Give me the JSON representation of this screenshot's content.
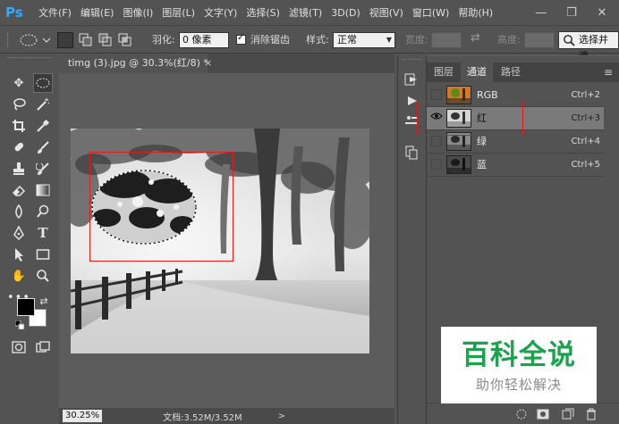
{
  "app": {
    "logo": "Ps"
  },
  "menu": [
    "文件(F)",
    "编辑(E)",
    "图像(I)",
    "图层(L)",
    "文字(Y)",
    "选择(S)",
    "滤镜(T)",
    "3D(D)",
    "视图(V)",
    "窗口(W)",
    "帮助(H)"
  ],
  "window_controls": {
    "minimize": "—",
    "restore": "❐",
    "close": "✕"
  },
  "options": {
    "feather_label": "羽化:",
    "feather_value": "0 像素",
    "antialias_label": "消除锯齿",
    "antialias_checked": true,
    "style_label": "样式:",
    "style_value": "正常",
    "width_label": "宽度:",
    "height_label": "高度:",
    "select_mask_button": "选择并遮"
  },
  "document": {
    "tab_title": "timg (3).jpg @ 30.3%(红/8) *",
    "tab_close": "×",
    "zoom": "30.25%",
    "doc_size": "文档:3.52M/3.52M",
    "status_arrow": ">"
  },
  "panel": {
    "tabs": [
      "图层",
      "通道",
      "路径"
    ],
    "active_tab": "通道",
    "menu_icon": "≡",
    "channels": [
      {
        "name": "RGB",
        "shortcut": "Ctrl+2",
        "visible": false,
        "active": false,
        "thumb_color": "color"
      },
      {
        "name": "红",
        "shortcut": "Ctrl+3",
        "visible": true,
        "active": true,
        "thumb_color": "bright"
      },
      {
        "name": "绿",
        "shortcut": "Ctrl+4",
        "visible": false,
        "active": false,
        "thumb_color": "mid"
      },
      {
        "name": "蓝",
        "shortcut": "Ctrl+5",
        "visible": false,
        "active": false,
        "thumb_color": "dark"
      }
    ]
  },
  "watermark": {
    "title": "百科全说",
    "subtitle": "助你轻松解决"
  },
  "colors": {
    "ui_bg": "#535353",
    "canvas_bg": "#5c5c5c",
    "annotation_red": "#e01b1b",
    "watermark_green": "#1aa34a",
    "ps_blue": "#31a8ff",
    "foreground_swatch": "#000000",
    "background_swatch": "#ffffff"
  }
}
